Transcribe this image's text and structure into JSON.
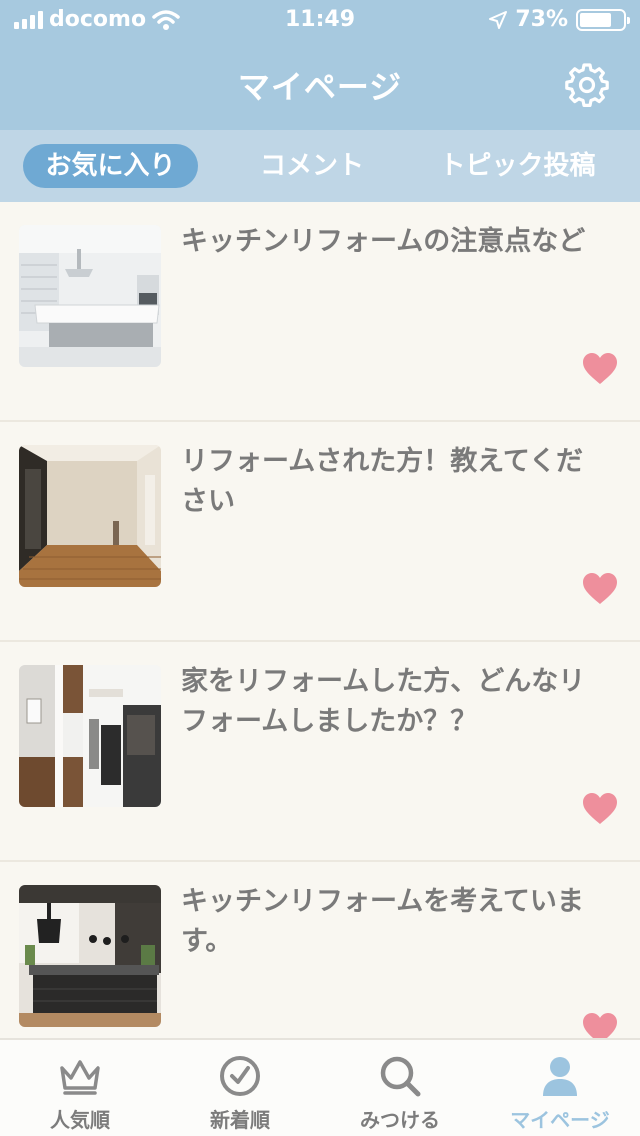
{
  "status_bar": {
    "carrier": "docomo",
    "time": "11:49",
    "battery": "73%",
    "battery_level": 0.73,
    "icons": [
      "signal-bars-icon",
      "wifi-icon",
      "location-arrow-icon",
      "battery-icon"
    ]
  },
  "header": {
    "title": "マイページ",
    "settings_icon": "gear-icon"
  },
  "tabs": [
    {
      "label": "お気に入り",
      "active": true
    },
    {
      "label": "コメント",
      "active": false
    },
    {
      "label": "トピック投稿",
      "active": false
    }
  ],
  "items": [
    {
      "title": "キッチンリフォームの注意点など",
      "thumbnail": "white-kitchen-photo",
      "favorited": true
    },
    {
      "title": "リフォームされた方！教えてください",
      "thumbnail": "empty-wooden-floor-room-photo",
      "favorited": true
    },
    {
      "title": "家をリフォームした方、どんなリフォームしましたか？？",
      "thumbnail": "entrance-closet-photo",
      "favorited": true
    },
    {
      "title": "キッチンリフォームを考えています。",
      "thumbnail": "dark-kitchen-island-photo",
      "favorited": true
    }
  ],
  "colors": {
    "header_bg": "#a7c9df",
    "tab_bar_bg": "#bfd6e6",
    "active_tab_bg": "#6fa9d3",
    "list_bg": "#f9f7f1",
    "heart": "#ee8f9c",
    "title_text": "#7a7a7a",
    "nav_active": "#9cc4df"
  },
  "bottom_nav": [
    {
      "label": "人気順",
      "icon": "crown-icon",
      "active": false
    },
    {
      "label": "新着順",
      "icon": "clock-icon",
      "active": false
    },
    {
      "label": "みつける",
      "icon": "search-icon",
      "active": false
    },
    {
      "label": "マイページ",
      "icon": "user-icon",
      "active": true
    }
  ]
}
